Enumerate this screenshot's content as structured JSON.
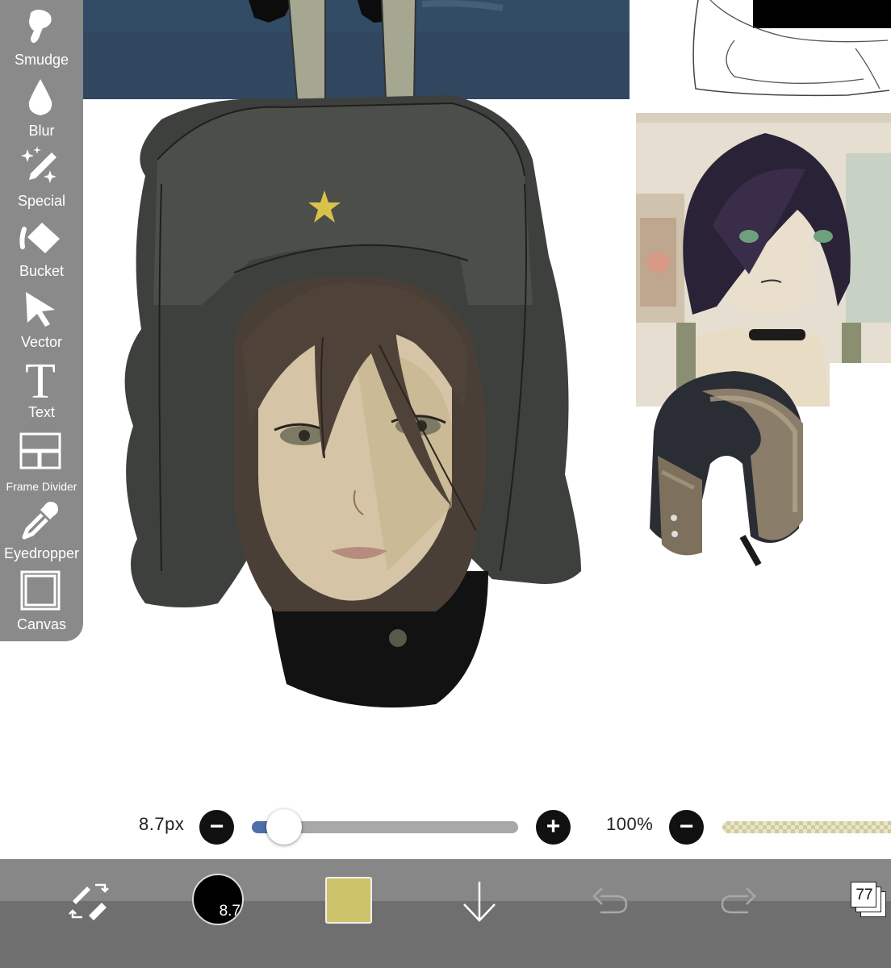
{
  "app": "ibisPaint",
  "left_toolbar": {
    "items": [
      {
        "label": "Smudge",
        "icon": "smudge-finger-icon"
      },
      {
        "label": "Blur",
        "icon": "blur-drop-icon"
      },
      {
        "label": "Special",
        "icon": "special-sparkle-pen-icon"
      },
      {
        "label": "Bucket",
        "icon": "bucket-fill-icon"
      },
      {
        "label": "Vector",
        "icon": "vector-cursor-icon"
      },
      {
        "label": "Text",
        "icon": "text-t-icon"
      },
      {
        "label": "Frame Divider",
        "icon": "frame-divider-icon"
      },
      {
        "label": "Eyedropper",
        "icon": "eyedropper-icon"
      },
      {
        "label": "Canvas",
        "icon": "canvas-square-icon"
      }
    ]
  },
  "brush": {
    "size_label": "8.7px",
    "size_value": 8.7,
    "size_fraction": 0.05,
    "opacity_label": "100%",
    "opacity_value": 100,
    "preview_label": "8.7"
  },
  "bottom_bar": {
    "current_color": "#ccc36a",
    "layer_count": "77",
    "buttons": [
      "swap-tools-icon",
      "brush-preview",
      "color-swatch",
      "down-arrow-icon",
      "undo-icon",
      "redo-icon",
      "layers-icon"
    ]
  },
  "colors": {
    "toolbar_bg": "#8a8a8a",
    "slider_accent": "#4e6fa8",
    "bottom_bar_bg": "#787878"
  }
}
